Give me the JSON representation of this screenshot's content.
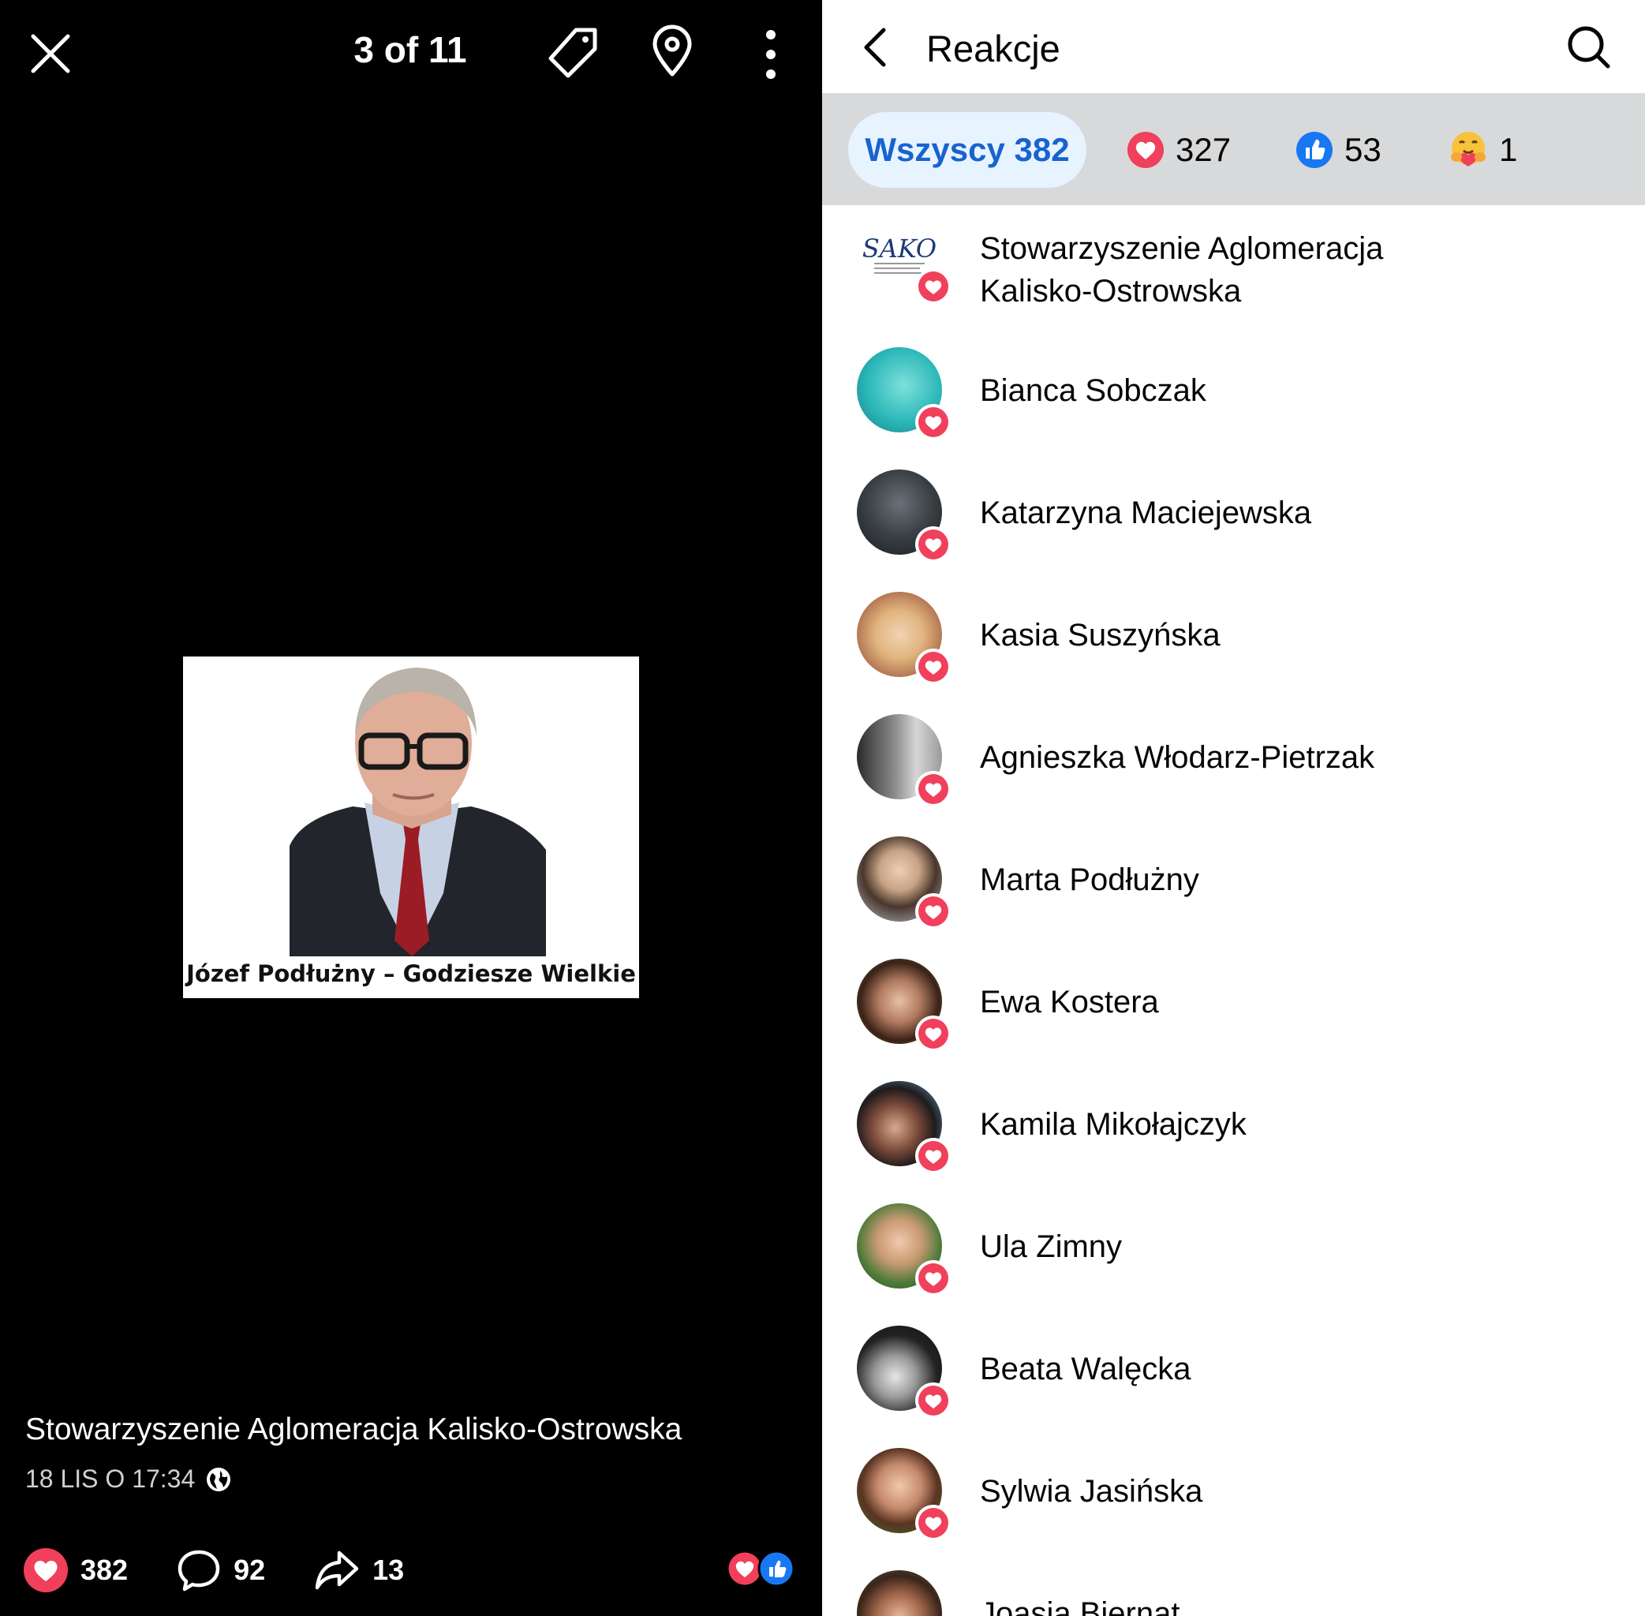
{
  "viewer": {
    "counter": "3 of 11",
    "photo_caption": "Józef Podłużny – Godziesze Wielkie",
    "author": "Stowarzyszenie Aglomeracja Kalisko-Ostrowska",
    "date": "18 LIS O 17:34",
    "reactions_count": "382",
    "comments_count": "92",
    "shares_count": "13"
  },
  "reactions_panel": {
    "title": "Reakcje",
    "filters": {
      "all_label": "Wszyscy 382",
      "love_count": "327",
      "like_count": "53",
      "care_count": "1"
    },
    "people": [
      {
        "name_line1": "Stowarzyszenie Aglomeracja",
        "name_line2": "Kalisko-Ostrowska",
        "logo_text": "SAKO"
      },
      {
        "name_line1": "Bianca Sobczak"
      },
      {
        "name_line1": "Katarzyna Maciejewska"
      },
      {
        "name_line1": "Kasia Suszyńska"
      },
      {
        "name_line1": "Agnieszka Włodarz-Pietrzak"
      },
      {
        "name_line1": "Marta Podłużny"
      },
      {
        "name_line1": "Ewa Kostera"
      },
      {
        "name_line1": "Kamila Mikołajczyk"
      },
      {
        "name_line1": "Ula Zimny"
      },
      {
        "name_line1": "Beata Walęcka"
      },
      {
        "name_line1": "Sylwia Jasińska"
      },
      {
        "name_line1": "Joasia Biernat"
      }
    ]
  },
  "colors": {
    "love": "#f0405c",
    "like": "#1877f2",
    "chip_bg": "#e7f3ff",
    "chip_text": "#1763cf",
    "filter_bar": "#d8d9db"
  }
}
